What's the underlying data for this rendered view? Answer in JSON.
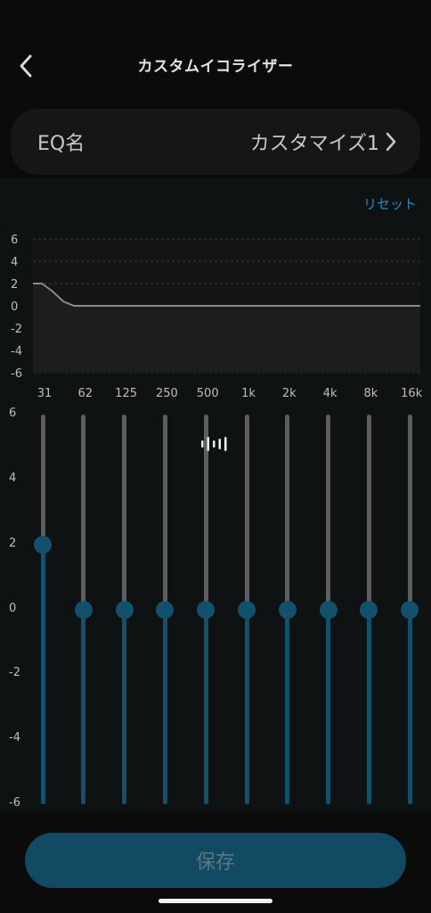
{
  "header": {
    "title": "カスタムイコライザー",
    "back_icon": "chevron-left-icon"
  },
  "eq_name": {
    "label": "EQ名",
    "value": "カスタマイズ1",
    "chevron_icon": "chevron-right-icon"
  },
  "reset_label": "リセット",
  "graph": {
    "y_ticks": [
      "6",
      "4",
      "2",
      "0",
      "-2",
      "-4",
      "-6"
    ],
    "y_range": [
      -6,
      6
    ]
  },
  "bands": [
    {
      "label": "31",
      "gain": 2
    },
    {
      "label": "62",
      "gain": 0
    },
    {
      "label": "125",
      "gain": 0
    },
    {
      "label": "250",
      "gain": 0
    },
    {
      "label": "500",
      "gain": 0
    },
    {
      "label": "1k",
      "gain": 0
    },
    {
      "label": "2k",
      "gain": 0
    },
    {
      "label": "4k",
      "gain": 0
    },
    {
      "label": "8k",
      "gain": 0
    },
    {
      "label": "16k",
      "gain": 0
    }
  ],
  "slider_scale": {
    "ticks": [
      "6",
      "4",
      "2",
      "0",
      "-2",
      "-4",
      "-6"
    ]
  },
  "center_icon": "waveform-icon",
  "save_label": "保存",
  "colors": {
    "accent": "#13506b",
    "link": "#1e8ec0",
    "track": "#5e5e5e",
    "background": "#0b0b0b"
  }
}
